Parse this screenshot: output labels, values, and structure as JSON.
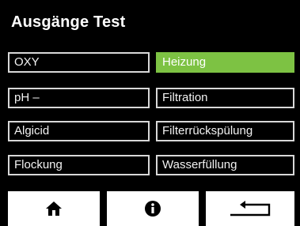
{
  "screen": {
    "title": "Ausgänge Test"
  },
  "outputs": [
    {
      "label": "OXY",
      "active": false
    },
    {
      "label": "Heizung",
      "active": true
    },
    {
      "label": "pH –",
      "active": false
    },
    {
      "label": "Filtration",
      "active": false
    },
    {
      "label": "Algicid",
      "active": false
    },
    {
      "label": "Filterrückspülung",
      "active": false
    },
    {
      "label": "Flockung",
      "active": false
    },
    {
      "label": "Wasserfüllung",
      "active": false
    }
  ],
  "nav": {
    "home_icon": "home-icon",
    "info_icon": "info-icon",
    "back_icon": "return-icon"
  },
  "colors": {
    "background": "#000000",
    "active": "#7dc243",
    "border": "#d8d8d8",
    "nav_button": "#ffffff"
  }
}
